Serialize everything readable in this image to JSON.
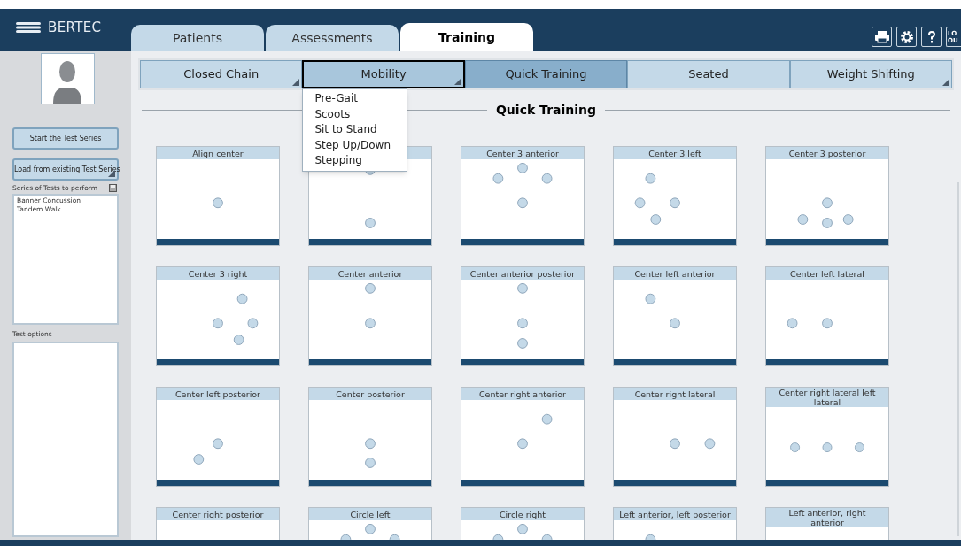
{
  "header": {
    "logo": "BERTEC",
    "tabs": [
      {
        "label": "Patients",
        "selected": false
      },
      {
        "label": "Assessments",
        "selected": false
      },
      {
        "label": "Training",
        "selected": true
      }
    ],
    "logout_lines": [
      "LO",
      "OU"
    ]
  },
  "sidebar": {
    "buttons": [
      {
        "label": "Start the Test Series",
        "has_menu": false
      },
      {
        "label": "Load from existing Test Series",
        "has_menu": true
      }
    ],
    "series_label": "Series of Tests to perform",
    "series_items": [
      "Banner Concussion",
      "Tandem Walk"
    ],
    "options_label": "Test options"
  },
  "subtabs": [
    {
      "label": "Closed Chain",
      "selected": false,
      "expanded": false,
      "has_menu": true
    },
    {
      "label": "Mobility",
      "selected": false,
      "expanded": true,
      "has_menu": true
    },
    {
      "label": "Quick Training",
      "selected": true,
      "expanded": false,
      "has_menu": false
    },
    {
      "label": "Seated",
      "selected": false,
      "expanded": false,
      "has_menu": false
    },
    {
      "label": "Weight Shifting",
      "selected": false,
      "expanded": false,
      "has_menu": true
    }
  ],
  "menu": {
    "items": [
      "Pre-Gait",
      "Scoots",
      "Sit to Stand",
      "Step Up/Down",
      "Stepping"
    ]
  },
  "section_title": "Quick Training",
  "cards": [
    {
      "title": "Align center"
    },
    {
      "kind": "covered"
    },
    {
      "title": "Center 3 anterior"
    },
    {
      "title": "Center 3 left"
    },
    {
      "title": "Center 3 posterior"
    },
    {
      "title": "Center 3 right"
    },
    {
      "title": "Center anterior"
    },
    {
      "title": "Center anterior posterior"
    },
    {
      "title": "Center left anterior"
    },
    {
      "title": "Center left lateral"
    },
    {
      "title": "Center left posterior"
    },
    {
      "title": "Center posterior"
    },
    {
      "title": "Center right anterior"
    },
    {
      "title": "Center right lateral"
    },
    {
      "title": "Center right lateral left lateral"
    },
    {
      "title": "Center right posterior"
    },
    {
      "title": "Circle left"
    },
    {
      "title": "Circle right"
    },
    {
      "title": "Left anterior, left posterior"
    },
    {
      "title": "Left anterior, right anterior"
    }
  ]
}
